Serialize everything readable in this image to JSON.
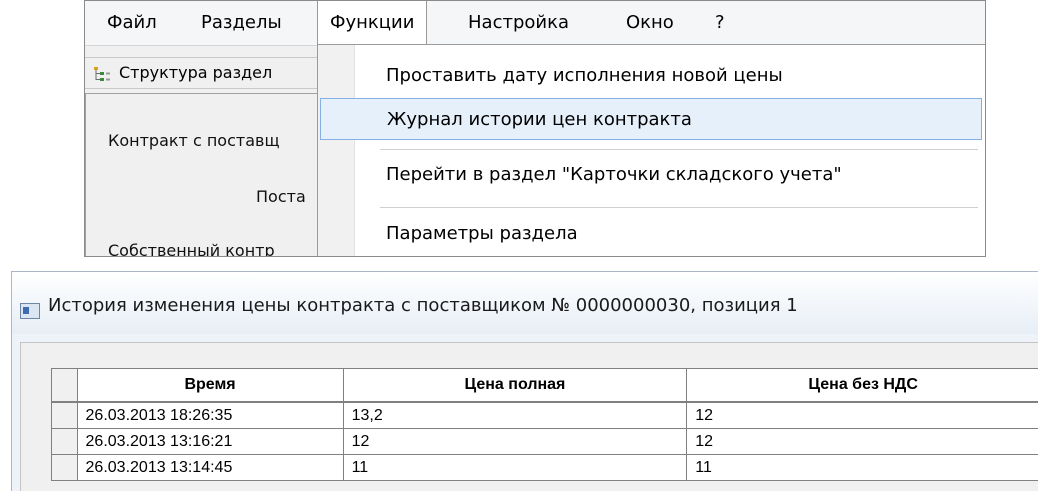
{
  "menubar": {
    "items": [
      "Файл",
      "Разделы",
      "Функции",
      "Настройка",
      "Окно",
      "?"
    ],
    "active_index": 2
  },
  "toolbar": {
    "label": "Структура раздел",
    "icon": "tree-structure-icon"
  },
  "form": {
    "labels": [
      "Контракт с поставщ",
      "Поста",
      "Собственный контр"
    ]
  },
  "dropdown": {
    "items": [
      "Проставить дату исполнения новой цены",
      "Журнал истории цен контракта",
      "Перейти в раздел \"Карточки складского учета\"",
      "Параметры раздела"
    ],
    "highlighted_index": 1
  },
  "window": {
    "title": "История изменения цены контракта с поставщиком № 0000000030, позиция 1",
    "icon": "window-app-icon"
  },
  "table": {
    "columns": [
      "Время",
      "Цена полная",
      "Цена без НДС"
    ],
    "rows": [
      [
        "26.03.2013 18:26:35",
        "13,2",
        "12"
      ],
      [
        "26.03.2013 13:16:21",
        "12",
        "12"
      ],
      [
        "26.03.2013 13:14:45",
        "11",
        "11"
      ]
    ]
  },
  "colors": {
    "highlight_bg": "#e6f0fb",
    "highlight_border": "#84b0e3",
    "grid_border": "#808080"
  }
}
